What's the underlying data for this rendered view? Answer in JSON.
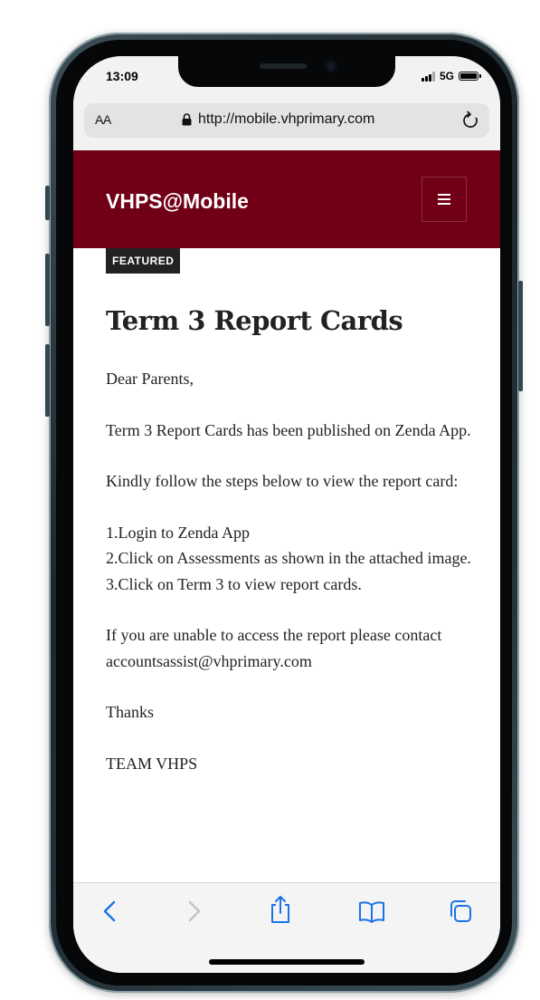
{
  "status_bar": {
    "time": "13:09",
    "network": "5G"
  },
  "browser": {
    "text_size_label": "AA",
    "url": "http://mobile.vhprimary.com",
    "accent_color": "#1a73e8"
  },
  "site": {
    "title": "VHPS@Mobile",
    "header_color": "#710017"
  },
  "article": {
    "badge": "FEATURED",
    "title": "Term 3 Report Cards",
    "greeting": "Dear Parents,",
    "paragraph_1": "Term 3 Report Cards has been published on Zenda App.",
    "paragraph_2": "Kindly follow the steps below to view the report card:",
    "step_1": "1.Login to Zenda App",
    "step_2": "2.Click on Assessments as shown in the attached image.",
    "step_3": "3.Click on Term 3 to view report cards.",
    "paragraph_3": "If you are unable to access the report please contact accountsassist@vhprimary.com",
    "thanks": "Thanks",
    "signature": "TEAM VHPS"
  },
  "toolbar": {
    "icons": [
      "back-icon",
      "forward-icon",
      "share-icon",
      "bookmarks-icon",
      "tabs-icon"
    ]
  }
}
